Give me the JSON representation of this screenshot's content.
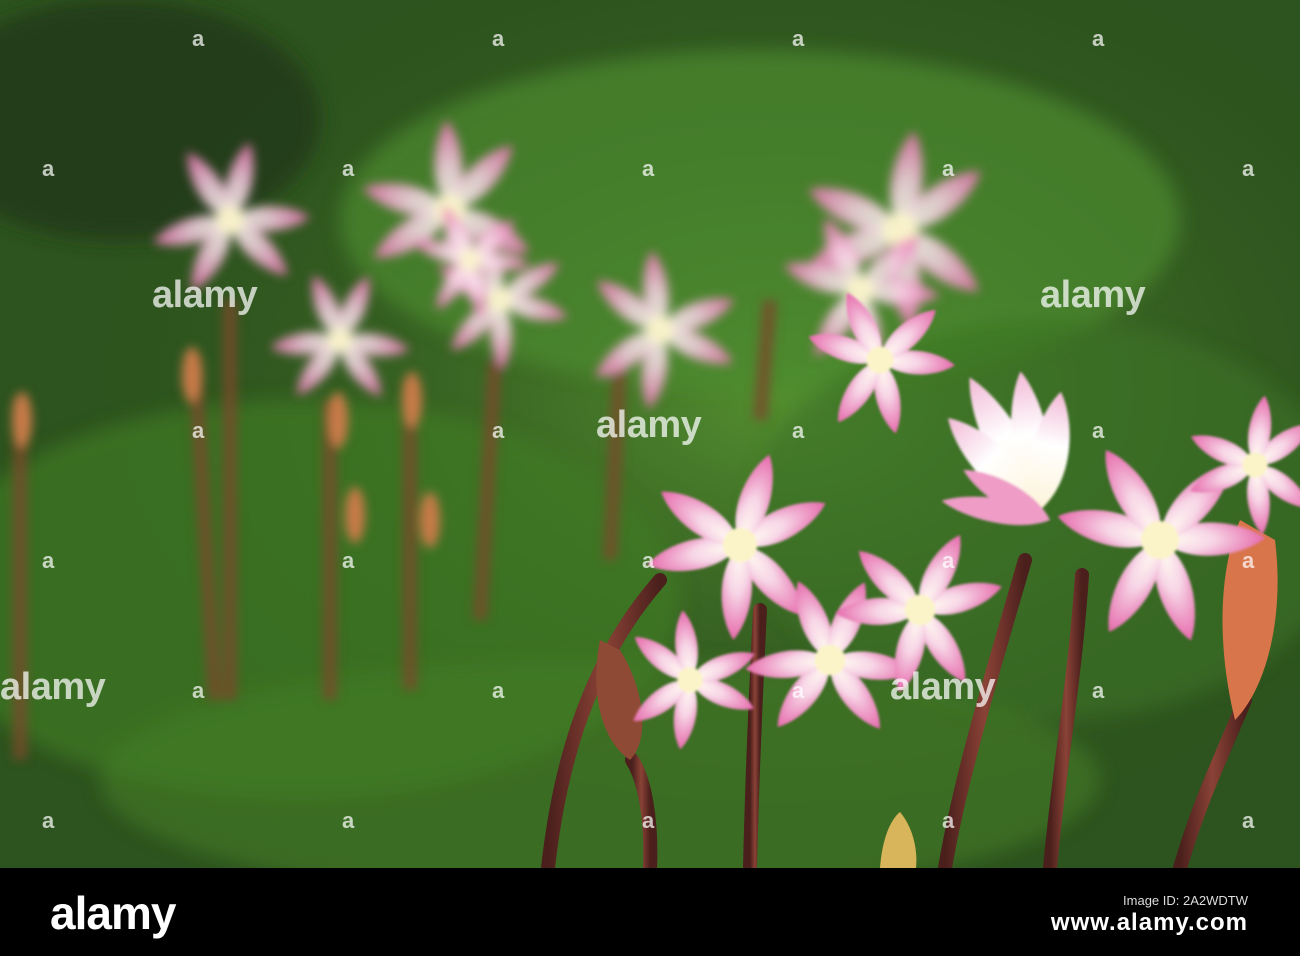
{
  "watermark": {
    "text": "alamy",
    "dot_glyph": "a"
  },
  "footer": {
    "logo": "alamy",
    "image_id_label": "Image ID: 2A2WDTW",
    "url": "www.alamy.com"
  },
  "photo": {
    "subject": "pink-and-white-lilies-on-grass",
    "colors": {
      "grass_dark": "#25431a",
      "grass_light": "#4f8a2e",
      "petal_pink": "#e87ab6",
      "petal_white": "#fbeef4",
      "stem": "#6b2e2a"
    }
  }
}
